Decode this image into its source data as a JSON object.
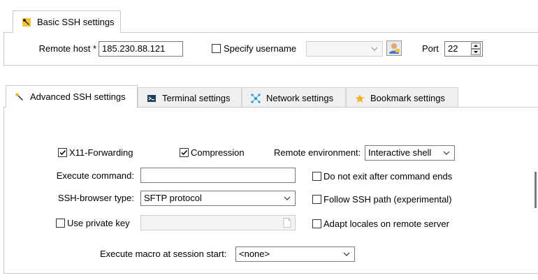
{
  "basic_tab": {
    "label": "Basic SSH settings"
  },
  "basic": {
    "remote_host_label": "Remote host *",
    "remote_host_value": "185.230.88.121",
    "specify_username_label": "Specify username",
    "specify_username_checked": false,
    "username_value": "",
    "port_label": "Port",
    "port_value": "22"
  },
  "tabs": [
    {
      "label": "Advanced SSH settings",
      "icon": "wrench-icon",
      "active": true
    },
    {
      "label": "Terminal settings",
      "icon": "terminal-icon",
      "active": false
    },
    {
      "label": "Network settings",
      "icon": "network-icon",
      "active": false
    },
    {
      "label": "Bookmark settings",
      "icon": "star-icon",
      "active": false
    }
  ],
  "advanced": {
    "x11_label": "X11-Forwarding",
    "x11_checked": true,
    "compression_label": "Compression",
    "compression_checked": true,
    "remote_env_label": "Remote environment:",
    "remote_env_value": "Interactive shell",
    "execute_command_label": "Execute command:",
    "execute_command_value": "",
    "do_not_exit_label": "Do not exit after command ends",
    "do_not_exit_checked": false,
    "browser_type_label": "SSH-browser type:",
    "browser_type_value": "SFTP protocol",
    "follow_path_label": "Follow SSH path (experimental)",
    "follow_path_checked": false,
    "private_key_label": "Use private key",
    "private_key_checked": false,
    "private_key_value": "",
    "adapt_locales_label": "Adapt locales on remote server",
    "adapt_locales_checked": false,
    "macro_label": "Execute macro at session start:",
    "macro_value": "<none>"
  },
  "colors": {
    "wrench": "#3a3a3a",
    "wrench_handle": "#e8b830",
    "star": "#f2b21a",
    "network": "#1aa0d8",
    "user_icon_bg": "#6a9fd0"
  }
}
